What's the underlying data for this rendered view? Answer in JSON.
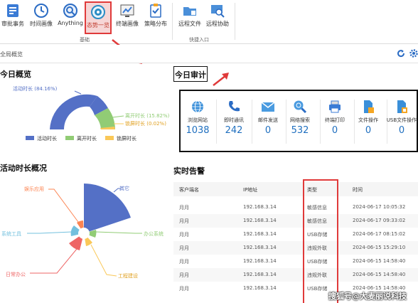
{
  "ribbon": {
    "tools": [
      {
        "label": "审批事务",
        "icon": "document-list-icon"
      },
      {
        "label": "时间画像",
        "icon": "clock-icon"
      },
      {
        "label": "Anything",
        "icon": "magnifier-icon"
      },
      {
        "label": "态势一览",
        "icon": "eye-target-icon",
        "active": true
      },
      {
        "label": "终端画像",
        "icon": "user-chart-icon"
      },
      {
        "label": "策略分布",
        "icon": "clipboard-icon"
      },
      {
        "label": "远程文件",
        "icon": "folder-icon"
      },
      {
        "label": "远程协助",
        "icon": "remote-search-icon"
      }
    ],
    "groups": [
      "基础",
      "快捷入口"
    ]
  },
  "breadcrumb": {
    "text": "全局概览"
  },
  "today_overview": {
    "title": "今日概览",
    "slices": [
      {
        "label": "活动时长 (84.16%)",
        "color": "#5470c6",
        "value": 84.16
      },
      {
        "label": "离开时长 (15.82%)",
        "color": "#91cc75",
        "value": 15.82
      },
      {
        "label": "锁屏时长 (0.02%)",
        "color": "#fac858",
        "value": 0.02
      }
    ],
    "legend": [
      "活动时长",
      "离开时长",
      "锁屏时长"
    ]
  },
  "activity": {
    "title": "活动时长概况",
    "labels": [
      "其它",
      "办公系统",
      "工程建设",
      "日常办公",
      "系统工具",
      "娱乐应用"
    ]
  },
  "audit": {
    "title": "今日审计",
    "items": [
      {
        "label": "浏览网站",
        "value": "1038",
        "icon": "globe-icon"
      },
      {
        "label": "即时通讯",
        "value": "242",
        "icon": "phone-icon"
      },
      {
        "label": "邮件发送",
        "value": "0",
        "icon": "mail-icon"
      },
      {
        "label": "网络搜索",
        "value": "532",
        "icon": "search-globe-icon"
      },
      {
        "label": "终端打印",
        "value": "0",
        "icon": "printer-icon"
      },
      {
        "label": "文件操作",
        "value": "0",
        "icon": "file-icon"
      },
      {
        "label": "USB文件操作",
        "value": "0",
        "icon": "usb-file-icon"
      }
    ]
  },
  "alerts": {
    "title": "实时告警",
    "columns": [
      "客户端名",
      "IP地址",
      "类型",
      "时间"
    ],
    "rows": [
      {
        "client": "月月",
        "ip": "192.168.3.14",
        "type": "敏感信息",
        "time": "2024-06-17 10:05:32"
      },
      {
        "client": "月月",
        "ip": "192.168.3.14",
        "type": "敏感信息",
        "time": "2024-06-17 09:33:02"
      },
      {
        "client": "月月",
        "ip": "192.168.3.14",
        "type": "USB存储",
        "time": "2024-06-17 08:15:02"
      },
      {
        "client": "月月",
        "ip": "192.168.3.14",
        "type": "违规外联",
        "time": "2024-06-15 15:29:10"
      },
      {
        "client": "月月",
        "ip": "192.168.3.14",
        "type": "USB存储",
        "time": "2024-06-15 14:58:40"
      },
      {
        "client": "月月",
        "ip": "192.168.3.14",
        "type": "违规外联",
        "time": "2024-06-15 14:58:40"
      },
      {
        "client": "月月",
        "ip": "192.168.3.14",
        "type": "USB存储",
        "time": "2024-06-15 14:58:40"
      }
    ]
  },
  "watermark": "搜狐号@大麦丽说科技",
  "colors": {
    "accent": "#1f6fbf",
    "highlight": "#e03a3a"
  }
}
